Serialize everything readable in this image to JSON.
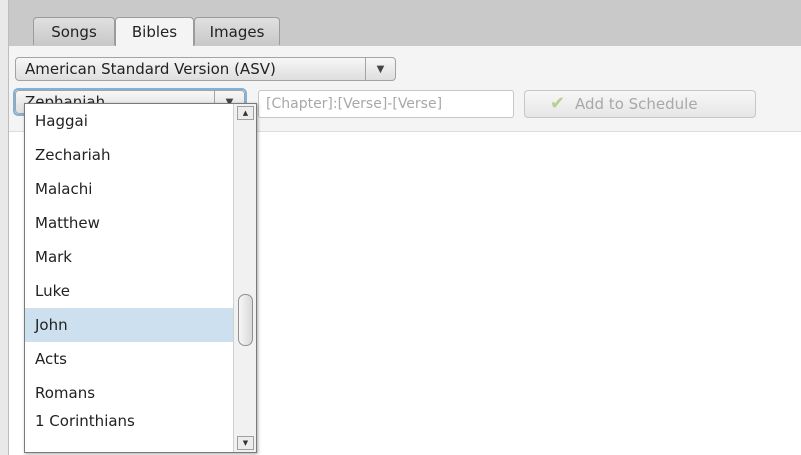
{
  "tabs": [
    {
      "label": "Songs",
      "active": false
    },
    {
      "label": "Bibles",
      "active": true
    },
    {
      "label": "Images",
      "active": false
    }
  ],
  "version_select": {
    "value": "American Standard Version (ASV)"
  },
  "book_select": {
    "value": "Zephaniah"
  },
  "reference_input": {
    "value": "",
    "placeholder": "[Chapter]:[Verse]-[Verse]"
  },
  "add_button": {
    "label": "Add to Schedule",
    "enabled": false
  },
  "book_list": {
    "items": [
      "Haggai",
      "Zechariah",
      "Malachi",
      "Matthew",
      "Mark",
      "Luke",
      "John",
      "Acts",
      "Romans",
      "1 Corinthians"
    ],
    "selected": "John"
  },
  "colors": {
    "tabbar": "#c9c9c9",
    "selection": "#cde0ef",
    "focus": "#7fb2db"
  }
}
